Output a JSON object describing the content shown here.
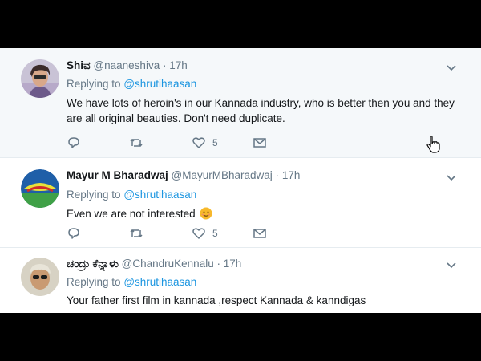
{
  "tweets": [
    {
      "name": "Shiವ",
      "handle": "@naaneshiva",
      "separator": "·",
      "time": "17h",
      "replying_label": "Replying to",
      "replying_to": "@shrutihaasan",
      "text": "We have lots of heroin's in our Kannada industry, who is better then you and they are all original beauties. Don't need duplicate.",
      "likes": "5",
      "avatar_icon": "user-avatar-photo",
      "highlighted": true
    },
    {
      "name": "Mayur M Bharadwaj",
      "handle": "@MayurMBharadwaj",
      "separator": "·",
      "time": "17h",
      "replying_label": "Replying to",
      "replying_to": "@shrutihaasan",
      "text": "Even we are not interested",
      "emoji": "smiling-face-emoji",
      "likes": "5",
      "avatar_icon": "user-avatar-logo"
    },
    {
      "name": "ಚಂದ್ರು ಕೆನ್ನಾಳು",
      "handle": "@ChandruKennalu",
      "separator": "·",
      "time": "17h",
      "replying_label": "Replying to",
      "replying_to": "@shrutihaasan",
      "text": "Your father first film in kannada ,respect Kannada & kanndigas",
      "avatar_icon": "user-avatar-photo"
    }
  ],
  "colors": {
    "link": "#1b95e0",
    "secondary_text": "#657786",
    "primary_text": "#14171a",
    "highlight_bg": "#f5f8fa",
    "divider": "#e6ecf0",
    "frame": "#000000"
  }
}
